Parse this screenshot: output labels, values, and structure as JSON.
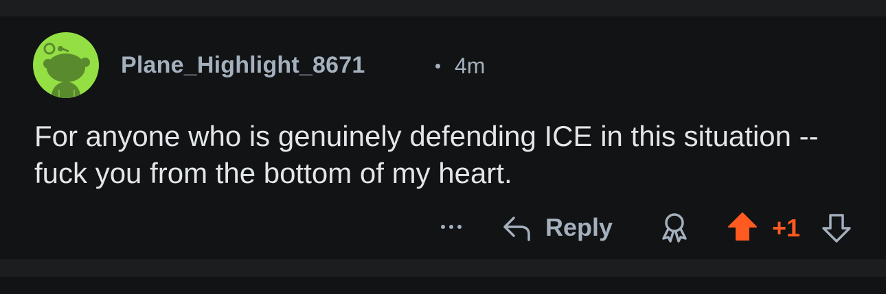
{
  "comment": {
    "author": "Plane_Highlight_8671",
    "separator": "•",
    "time_ago": "4m",
    "body": "For anyone who is genuinely defending ICE in this situation -- fuck you from the bottom of my heart."
  },
  "actions": {
    "more_icon": "ellipsis-icon",
    "reply_icon": "reply-arrow-icon",
    "reply_label": "Reply",
    "award_icon": "award-icon",
    "upvote_icon": "upvote-arrow-icon",
    "score": "+1",
    "downvote_icon": "downvote-arrow-icon"
  },
  "colors": {
    "background": "#111315",
    "divider": "#1c1d1f",
    "meta_text": "#a4b0bd",
    "body_text": "#e3e6e8",
    "upvote_accent": "#ff5a1f",
    "avatar_bg": "#94e044",
    "avatar_figure": "#5a8a2e"
  }
}
